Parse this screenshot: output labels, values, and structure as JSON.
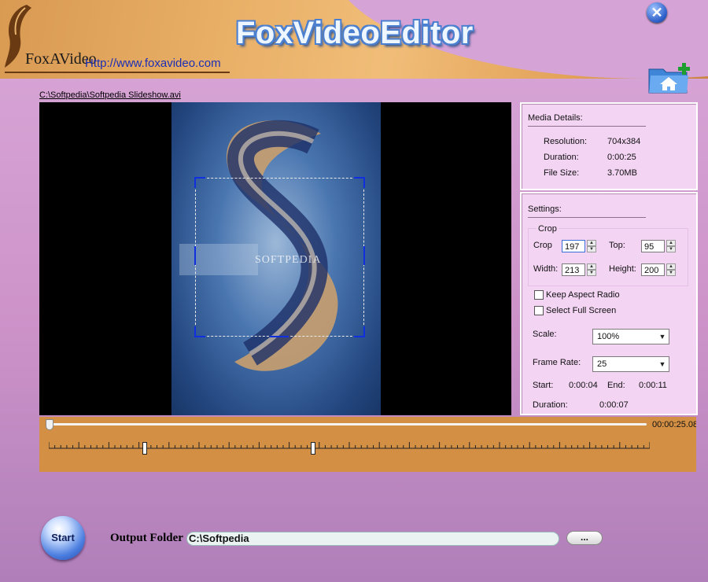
{
  "app": {
    "title": "FoxVideoEditor",
    "logo_text": "FoxAVideo",
    "logo_url": "Http://www.foxavideo.com",
    "close_icon": "close-icon",
    "folder_icon": "open-folder-icon"
  },
  "file_path": "C:\\Softpedia\\Softpedia Slideshow.avi",
  "preview": {
    "watermark": "SOFTPEDIA"
  },
  "media_details": {
    "title": "Media Details:",
    "resolution_label": "Resolution:",
    "resolution": "704x384",
    "duration_label": "Duration:",
    "duration": "0:00:25",
    "filesize_label": "File Size:",
    "filesize": "3.70MB"
  },
  "settings": {
    "title": "Settings:",
    "crop_group": "Crop",
    "crop_label": "Crop",
    "crop_value": "197",
    "top_label": "Top:",
    "top_value": "95",
    "width_label": "Width:",
    "width_value": "213",
    "height_label": "Height:",
    "height_value": "200",
    "keep_aspect_label": "Keep Aspect Radio",
    "keep_aspect_checked": false,
    "full_screen_label": "Select Full Screen",
    "full_screen_checked": false,
    "scale_label": "Scale:",
    "scale_value": "100%",
    "frame_rate_label": "Frame Rate:",
    "frame_rate_value": "25",
    "start_label": "Start:",
    "start_value": "0:00:04",
    "end_label": "End:",
    "end_value": "0:00:11",
    "duration_label": "Duration:",
    "duration_value": "0:00:07"
  },
  "timeline": {
    "total_time": "00:00:25.08",
    "position": 0.0,
    "selection_start": 4,
    "selection_end": 11,
    "total_seconds": 25
  },
  "bottom": {
    "start_label": "Start",
    "output_label": "Output Folder",
    "output_value": "C:\\Softpedia",
    "browse_label": "..."
  },
  "colors": {
    "background": "#cd93c9",
    "panel": "#f3d4f3",
    "timeline": "#d38f44",
    "accent": "#1030e0"
  }
}
